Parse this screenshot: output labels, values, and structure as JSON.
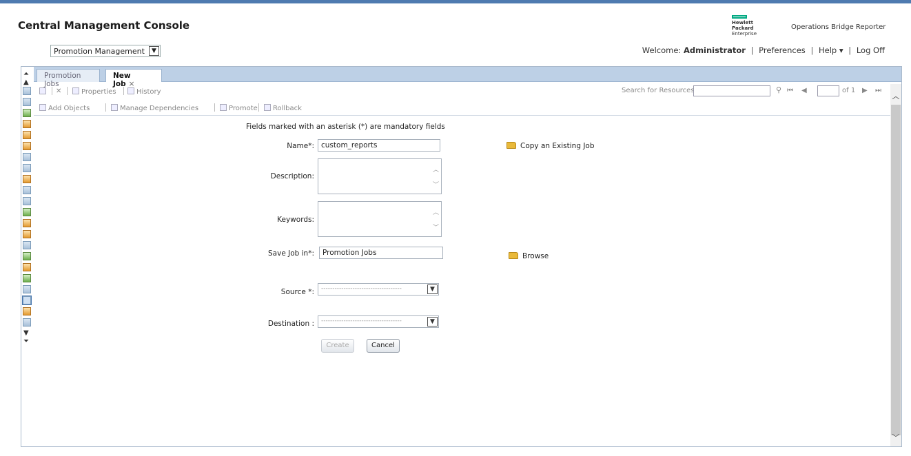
{
  "header": {
    "title": "Central Management Console",
    "logo_line1": "Hewlett Packard",
    "logo_line2": "Enterprise",
    "product": "Operations Bridge Reporter"
  },
  "app_selector": {
    "value": "Promotion Management"
  },
  "userbar": {
    "welcome_prefix": "Welcome:",
    "user": "Administrator",
    "preferences": "Preferences",
    "help": "Help ▾",
    "logoff": "Log Off"
  },
  "tabs": [
    {
      "label": "Promotion Jobs"
    },
    {
      "label": "New Job",
      "close": "×"
    }
  ],
  "toolbar1": {
    "properties": "Properties",
    "history": "History",
    "search_label": "Search for Resources",
    "page_of": "of 1"
  },
  "toolbar2": {
    "add_objects": "Add Objects",
    "manage_dependencies": "Manage Dependencies",
    "promote": "Promote",
    "rollback": "Rollback"
  },
  "form": {
    "mandatory_note": "Fields marked with an asterisk (*) are mandatory fields",
    "name_label": "Name*:",
    "name_value": "custom_reports",
    "description_label": "Description:",
    "keywords_label": "Keywords:",
    "save_in_label": "Save Job in*:",
    "save_in_value": "Promotion Jobs",
    "source_label": "Source *:",
    "source_value": "------------------------------------",
    "destination_label": "Destination :",
    "destination_value": "------------------------------------",
    "copy_link": "Copy an Existing Job",
    "browse_link": "Browse",
    "create_button": "Create",
    "cancel_button": "Cancel"
  },
  "colors": {
    "topbar": "#4f7bb0",
    "tabbar": "#bdd0e6",
    "folder": "#e9b93a",
    "hpe_green": "#00a982"
  }
}
